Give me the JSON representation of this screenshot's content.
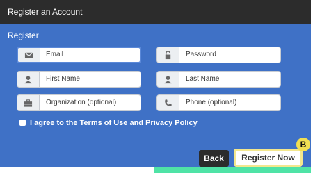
{
  "title_bar": {
    "title": "Register an Account"
  },
  "form": {
    "section_title": "Register",
    "fields": [
      {
        "id": "email",
        "label": "Email",
        "icon": "envelope-icon"
      },
      {
        "id": "password",
        "label": "Password",
        "icon": "lock-icon"
      },
      {
        "id": "first_name",
        "label": "First Name",
        "icon": "user-icon"
      },
      {
        "id": "last_name",
        "label": "Last Name",
        "icon": "user-icon"
      },
      {
        "id": "organization",
        "label": "Organization (optional)",
        "icon": "briefcase-icon"
      },
      {
        "id": "phone",
        "label": "Phone (optional)",
        "icon": "phone-icon"
      }
    ],
    "agree": {
      "prefix": "I agree to the",
      "terms_link": "Terms of Use",
      "conjunction": "and",
      "privacy_link": "Privacy Policy"
    }
  },
  "footer": {
    "back_label": "Back",
    "register_label": "Register Now",
    "badge_label": "B"
  },
  "colors": {
    "dialog_bg": "#3f71c6",
    "title_bar_bg": "#2c2c2c",
    "highlight": "#f3e78e",
    "badge": "#f1df52",
    "accent_strip": "#4fe3a6"
  }
}
